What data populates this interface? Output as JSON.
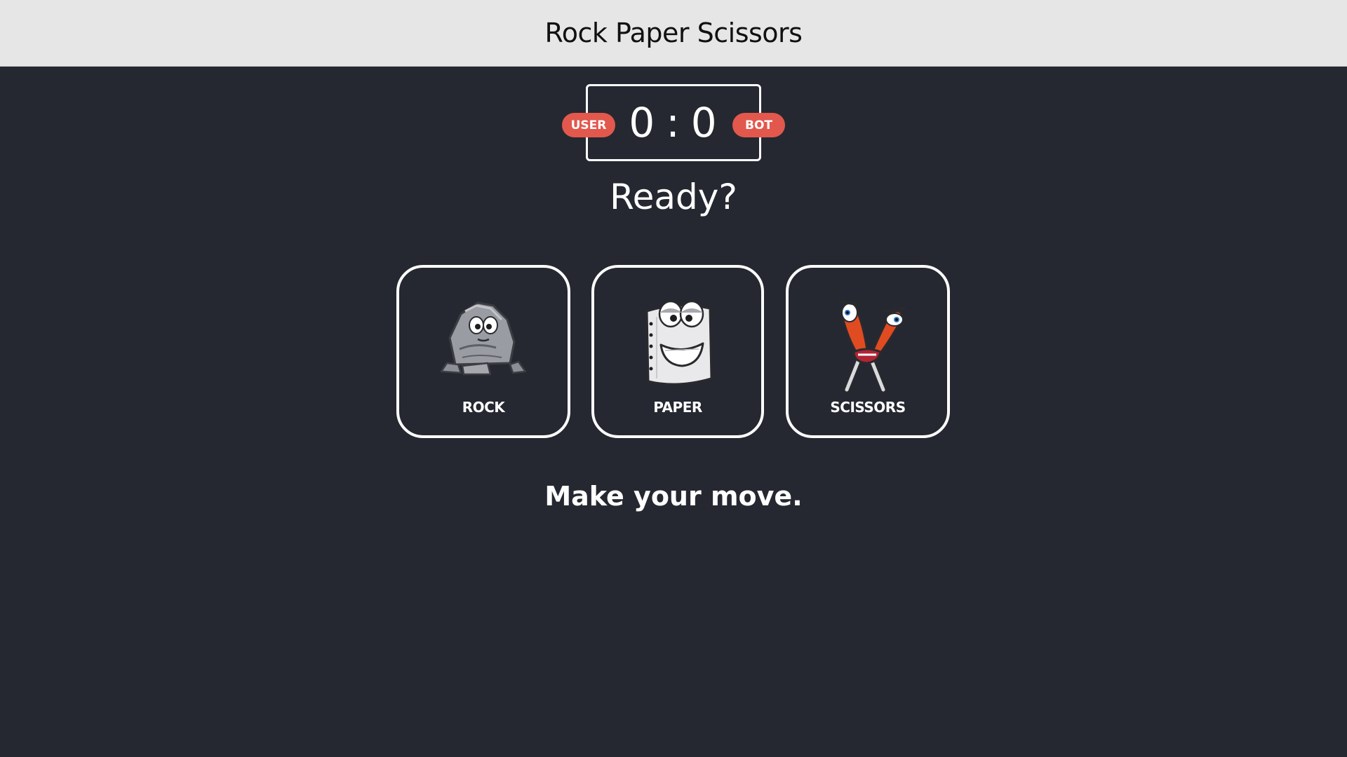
{
  "header": {
    "title": "Rock Paper Scissors"
  },
  "score": {
    "user_label": "USER",
    "bot_label": "BOT",
    "user": "0",
    "separator": ":",
    "bot": "0"
  },
  "status": "Ready?",
  "choices": [
    {
      "label": "ROCK",
      "icon": "rock-character-icon"
    },
    {
      "label": "PAPER",
      "icon": "paper-character-icon"
    },
    {
      "label": "SCISSORS",
      "icon": "scissors-character-icon"
    }
  ],
  "message": "Make your move.",
  "colors": {
    "background": "#252831",
    "header": "#e6e6e6",
    "badge": "#e2584d",
    "scissors_accent": "#e04b22"
  }
}
